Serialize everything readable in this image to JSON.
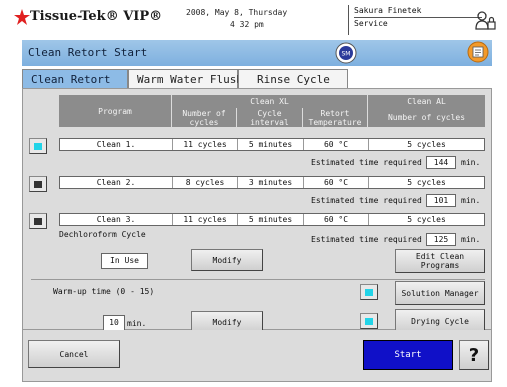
{
  "header": {
    "brand": "Tissue-Tek",
    "brand_suffix": "VIP",
    "date": "2008, May 8, Thursday",
    "time": "4 32 pm",
    "company": "Sakura Finetek",
    "mode": "Service"
  },
  "title": "Clean Retort Start",
  "tabs": [
    {
      "label": "Clean Retort",
      "active": true
    },
    {
      "label": "Warm Water Flush",
      "active": false
    },
    {
      "label": "Rinse Cycle",
      "active": false
    }
  ],
  "table": {
    "group_xl": "Clean XL",
    "group_al": "Clean AL",
    "col_program": "Program",
    "col_cycles": "Number of cycles",
    "col_interval": "Cycle interval",
    "col_temp": "Retort Temperature",
    "col_al_cycles": "Number of cycles",
    "rows": [
      {
        "program": "Clean 1.",
        "cycles": "11 cycles",
        "interval": "5 minutes",
        "temp": "60 °C",
        "al_cycles": "5 cycles",
        "selected": true,
        "est": "144"
      },
      {
        "program": "Clean 2.",
        "cycles": "8 cycles",
        "interval": "3 minutes",
        "temp": "60 °C",
        "al_cycles": "5 cycles",
        "selected": false,
        "est": "101"
      },
      {
        "program": "Clean 3.",
        "cycles": "11 cycles",
        "interval": "5 minutes",
        "temp": "60 °C",
        "al_cycles": "5 cycles",
        "selected": false,
        "est": "125"
      }
    ],
    "est_label": "Estimated time required",
    "est_unit": "min."
  },
  "dechloro": {
    "label": "Dechloroform Cycle",
    "value": "In Use",
    "modify": "Modify"
  },
  "edit_clean_programs": "Edit Clean Programs",
  "warmup": {
    "label": "Warm-up time (0 - 15)",
    "value": "10",
    "unit": "min.",
    "modify": "Modify"
  },
  "solution_manager": "Solution Manager",
  "drying_cycle": "Drying Cycle",
  "footer": {
    "cancel": "Cancel",
    "start": "Start",
    "help": "?"
  },
  "colors": {
    "indicator_on": "#22d4e8",
    "start_bg": "#1010c8",
    "title_bar": "#8dbbe6"
  }
}
